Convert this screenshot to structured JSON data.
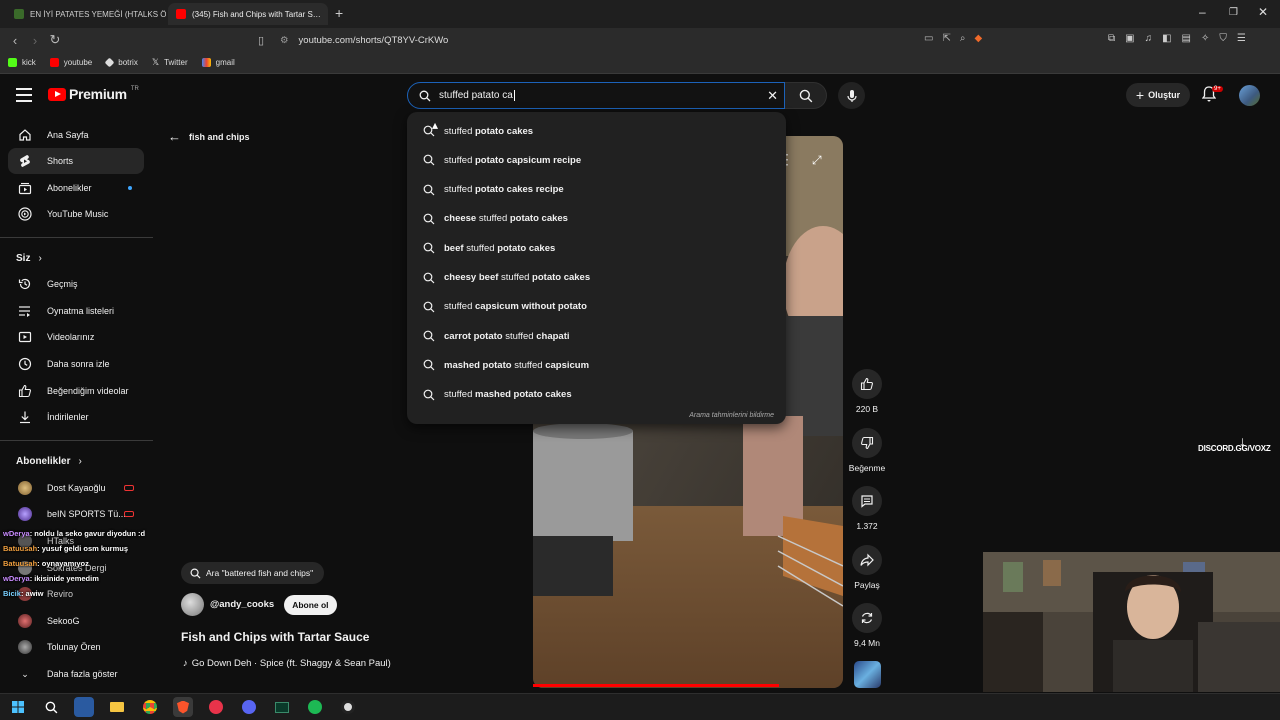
{
  "browser": {
    "tabs": [
      {
        "title": "EN İYİ PATATES YEMEĞİ (HTALKS ÖZE…"
      },
      {
        "title": "(345) Fish and Chips with Tartar S…"
      }
    ],
    "url": "youtube.com/shorts/QT8YV-CrKWo",
    "bookmarks": [
      "kick",
      "youtube",
      "botrix",
      "Twitter",
      "gmail"
    ]
  },
  "header": {
    "logo_word": "Premium",
    "logo_region": "TR",
    "search_value": "stuffed patato ca",
    "create_label": "Oluştur",
    "notif_badge": "9+"
  },
  "sidebar": {
    "main": [
      "Ana Sayfa",
      "Shorts",
      "Abonelikler",
      "YouTube Music"
    ],
    "you_header": "Siz",
    "you_items": [
      "Geçmiş",
      "Oynatma listeleri",
      "Videolarınız",
      "Daha sonra izle",
      "Beğendiğim videolar",
      "İndirilenler"
    ],
    "subs_header": "Abonelikler",
    "subs": [
      "Dost Kayaoğlu",
      "beIN SPORTS Tü...",
      "HTalks",
      "Sokrates Dergi",
      "Reviro",
      "SekooG",
      "Tolunay Ören"
    ],
    "more": "Daha fazla göster"
  },
  "chat": [
    {
      "user": "wDerya",
      "msg": ": noldu la seko gavur diyodun :d"
    },
    {
      "user": "Batuusah",
      "msg": ": yusuf geldi osm kurmuş"
    },
    {
      "user": "Batuusah",
      "msg": ": oynayamıyoz"
    },
    {
      "user": "wDerya",
      "msg": ": ikisinide yemedim"
    },
    {
      "user": "Bicik",
      "msg": ": awiw"
    }
  ],
  "back_label": "fish and chips",
  "suggestions": [
    [
      [
        "stuffed ",
        false
      ],
      [
        "potato cakes",
        true
      ]
    ],
    [
      [
        "stuffed ",
        false
      ],
      [
        "potato capsicum recipe",
        true
      ]
    ],
    [
      [
        "stuffed ",
        false
      ],
      [
        "potato cakes recipe",
        true
      ]
    ],
    [
      [
        "cheese ",
        true
      ],
      [
        "stuffed ",
        false
      ],
      [
        "potato cakes",
        true
      ]
    ],
    [
      [
        "beef ",
        true
      ],
      [
        "stuffed ",
        false
      ],
      [
        "potato cakes",
        true
      ]
    ],
    [
      [
        "cheesy beef ",
        true
      ],
      [
        "stuffed ",
        false
      ],
      [
        "potato cakes",
        true
      ]
    ],
    [
      [
        "stuffed ",
        false
      ],
      [
        "capsicum without potato",
        true
      ]
    ],
    [
      [
        "carrot potato ",
        true
      ],
      [
        "stuffed ",
        false
      ],
      [
        "chapati",
        true
      ]
    ],
    [
      [
        "mashed potato ",
        true
      ],
      [
        "stuffed ",
        false
      ],
      [
        "capsicum",
        true
      ]
    ],
    [
      [
        "stuffed ",
        false
      ],
      [
        "mashed potato cakes",
        true
      ]
    ]
  ],
  "report_label": "Arama tahminlerini bildirme",
  "actions": {
    "like": "220 B",
    "dislike": "Beğenme",
    "comments": "1.372",
    "share": "Paylaş",
    "remix": "9,4 Mn"
  },
  "video": {
    "related_search": "Ara \"battered fish and chips\"",
    "channel": "@andy_cooks",
    "subscribe": "Abone ol",
    "title": "Fish and Chips with Tartar Sauce",
    "music": "Go Down Deh · Spice (ft. Shaggy & Sean Paul)"
  },
  "overlay": {
    "discord": "DISCORD.GG/VOXZ"
  },
  "colors": {
    "accent": "#ff0000",
    "link": "#3ea6ff",
    "bg": "#0f0f0f"
  }
}
